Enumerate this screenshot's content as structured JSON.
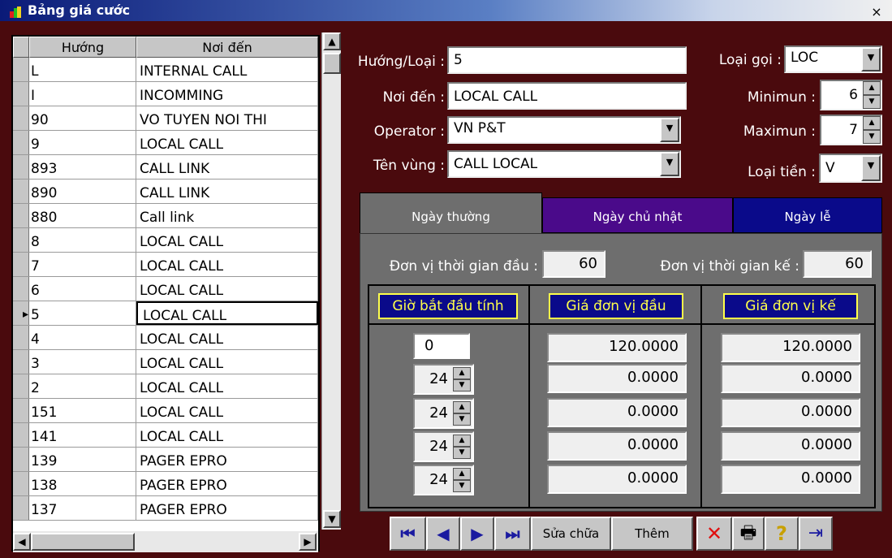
{
  "window": {
    "title": "Bảng giá cước",
    "close_label": "×"
  },
  "grid": {
    "columns": [
      "Hướng",
      "Nơi đến"
    ],
    "rows": [
      [
        "L",
        "INTERNAL CALL"
      ],
      [
        "I",
        "INCOMMING"
      ],
      [
        "90",
        "VO TUYEN NOI THI"
      ],
      [
        "9",
        "LOCAL CALL"
      ],
      [
        "893",
        "CALL LINK"
      ],
      [
        "890",
        "CALL LINK"
      ],
      [
        "880",
        "Call link"
      ],
      [
        "8",
        "LOCAL CALL"
      ],
      [
        "7",
        "LOCAL CALL"
      ],
      [
        "6",
        "LOCAL CALL"
      ],
      [
        "5",
        "LOCAL CALL"
      ],
      [
        "4",
        "LOCAL CALL"
      ],
      [
        "3",
        "LOCAL CALL"
      ],
      [
        "2",
        "LOCAL CALL"
      ],
      [
        "151",
        "LOCAL CALL"
      ],
      [
        "141",
        "LOCAL CALL"
      ],
      [
        "139",
        "PAGER EPRO"
      ],
      [
        "138",
        "PAGER EPRO"
      ],
      [
        "137",
        "PAGER EPRO"
      ]
    ],
    "selected_row": 10,
    "scroll_up": "▲",
    "scroll_down": "▼",
    "scroll_left": "◀",
    "scroll_right": "▶",
    "current_row_marker": "▸"
  },
  "form": {
    "huong_loai_label": "Hướng/Loại :",
    "huong_loai_value": "5",
    "noi_den_label": "Nơi đến :",
    "noi_den_value": "LOCAL CALL",
    "operator_label": "Operator :",
    "operator_value": "VN P&T",
    "ten_vung_label": "Tên vùng :",
    "ten_vung_value": "CALL LOCAL",
    "loai_goi_label": "Loại gọi :",
    "loai_goi_value": "LOC",
    "minimun_label": "Minimun :",
    "minimun_value": "6",
    "maximun_label": "Maximun :",
    "maximun_value": "7",
    "loai_tien_label": "Loại tiền :",
    "loai_tien_value": "V",
    "dropdown_arrow": "▼",
    "spin_up": "▲",
    "spin_down": "▼"
  },
  "tabs": [
    {
      "label": "Ngày thường",
      "active": true
    },
    {
      "label": "Ngày chủ nhật",
      "active": false
    },
    {
      "label": "Ngày lễ",
      "active": false
    }
  ],
  "pricing": {
    "first_unit_label": "Đơn vị thời gian đầu :",
    "first_unit_value": "60",
    "next_unit_label": "Đơn vị thời gian kế :",
    "next_unit_value": "60",
    "col_headers": [
      "Giờ bắt đầu tính",
      "Giá đơn vị đầu",
      "Giá đơn vị kế"
    ],
    "rows": [
      {
        "start": "0",
        "first": "120.0000",
        "next": "120.0000"
      },
      {
        "start": "24",
        "first": "0.0000",
        "next": "0.0000"
      },
      {
        "start": "24",
        "first": "0.0000",
        "next": "0.0000"
      },
      {
        "start": "24",
        "first": "0.0000",
        "next": "0.0000"
      },
      {
        "start": "24",
        "first": "0.0000",
        "next": "0.0000"
      }
    ]
  },
  "toolbar": {
    "first_icon": "⏮",
    "prev_icon": "◀",
    "next_icon": "▶",
    "last_icon": "⏭",
    "edit_label": "Sửa chữa",
    "add_label": "Thêm",
    "delete_icon": "✕",
    "print_icon": "🖶",
    "help_icon": "?",
    "exit_icon": "⇥"
  },
  "colors": {
    "window_bg": "#4a0a0d",
    "tab_purple": "#4a0a8a",
    "tab_blue": "#0a0a8a",
    "header_btn_text": "#ffff4a",
    "nav_icon": "#1a1aa0",
    "delete_icon": "#e01010"
  }
}
